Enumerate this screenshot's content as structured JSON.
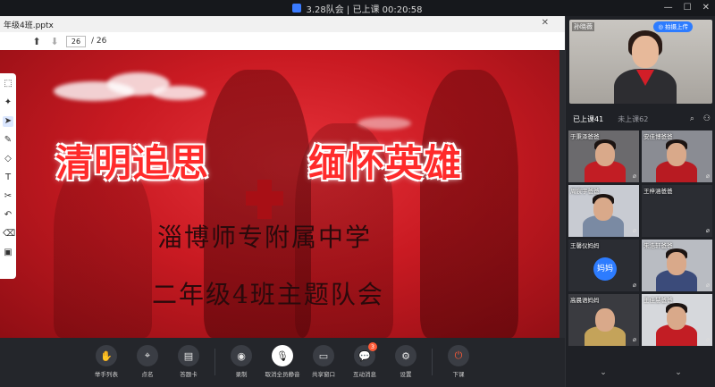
{
  "window": {
    "title": "3.28队会 | 已上课 00:20:58"
  },
  "document": {
    "filename": "年级4班.pptx",
    "page_current": "26",
    "page_total": "/ 26"
  },
  "slide": {
    "headline_left": "清明追思",
    "headline_right": "缅怀英雄",
    "school": "淄博师专附属中学",
    "event": "二年级4班主题队会"
  },
  "left_tools": [
    "selection-icon",
    "pointer-icon",
    "cursor-icon",
    "pen-icon",
    "shapes-icon",
    "text-icon",
    "scissors-icon",
    "undo-icon",
    "eraser-icon",
    "toolbox-icon"
  ],
  "bottom_toolbar": {
    "buttons": [
      {
        "label": "举手列表",
        "icon": "hand-icon"
      },
      {
        "label": "点名",
        "icon": "location-pin-icon"
      },
      {
        "label": "答题卡",
        "icon": "answer-card-icon"
      },
      {
        "label": "录制",
        "icon": "record-icon"
      },
      {
        "label": "取消全员静音",
        "icon": "mic-unmute-icon"
      },
      {
        "label": "共享窗口",
        "icon": "share-window-icon"
      },
      {
        "label": "互动消息",
        "icon": "chat-icon",
        "badge": "3"
      },
      {
        "label": "设置",
        "icon": "gear-icon"
      },
      {
        "label": "下课",
        "icon": "power-icon"
      }
    ]
  },
  "teacher": {
    "name": "孙晓薇",
    "upload_label": "拍摄上传"
  },
  "attendance_tabs": {
    "active": "已上课41",
    "inactive": "未上课62"
  },
  "students": [
    {
      "name": "于秉泽爸爸"
    },
    {
      "name": "安佳博爸爸"
    },
    {
      "name": "周宸宇爸爸"
    },
    {
      "name": "王梓涵爸爸"
    },
    {
      "name": "王馨仪妈妈",
      "avatar_text": "妈妈"
    },
    {
      "name": "朱浩轩爸爸"
    },
    {
      "name": "高晨语妈妈"
    },
    {
      "name": "王佳慧爸爸"
    }
  ],
  "colors": {
    "accent_blue": "#2d7cff",
    "slide_red": "#d42128",
    "hangup": "#ff5a36"
  }
}
